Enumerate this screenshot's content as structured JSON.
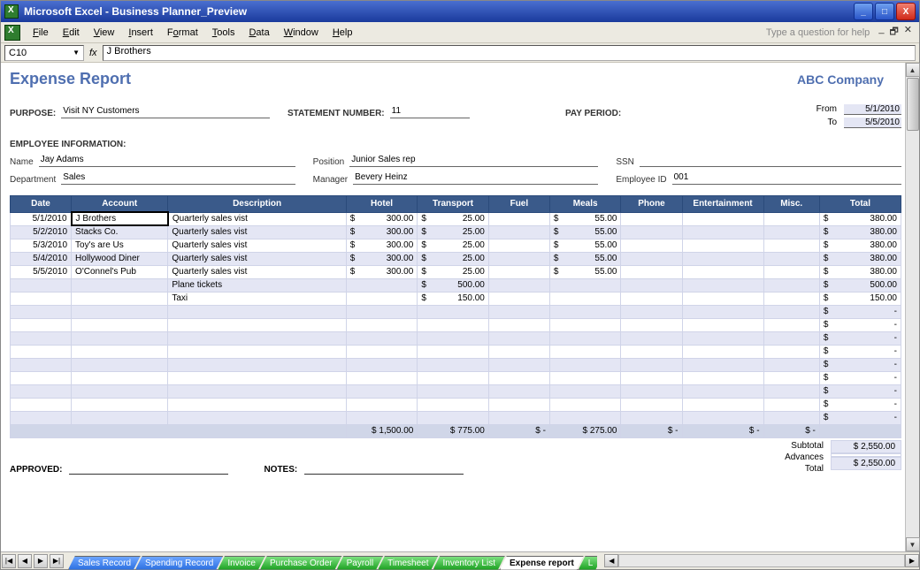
{
  "window": {
    "title": "Microsoft Excel - Business Planner_Preview"
  },
  "menu": {
    "file": "File",
    "edit": "Edit",
    "view": "View",
    "insert": "Insert",
    "format": "Format",
    "tools": "Tools",
    "data": "Data",
    "window": "Window",
    "help": "Help",
    "question_placeholder": "Type a question for help"
  },
  "formula_bar": {
    "cell_ref": "C10",
    "fx": "fx",
    "value": "J Brothers"
  },
  "report": {
    "title": "Expense Report",
    "company": "ABC Company",
    "purpose_label": "PURPOSE:",
    "purpose_value": "Visit NY Customers",
    "statement_label": "STATEMENT NUMBER:",
    "statement_value": "11",
    "payperiod_label": "PAY PERIOD:",
    "from_label": "From",
    "from_value": "5/1/2010",
    "to_label": "To",
    "to_value": "5/5/2010",
    "emp_section": "EMPLOYEE INFORMATION:",
    "name_label": "Name",
    "name_value": "Jay Adams",
    "dept_label": "Department",
    "dept_value": "Sales",
    "position_label": "Position",
    "position_value": "Junior Sales rep",
    "manager_label": "Manager",
    "manager_value": "Bevery Heinz",
    "ssn_label": "SSN",
    "ssn_value": "",
    "empid_label": "Employee ID",
    "empid_value": "001",
    "approved_label": "APPROVED:",
    "notes_label": "NOTES:"
  },
  "columns": {
    "date": "Date",
    "account": "Account",
    "description": "Description",
    "hotel": "Hotel",
    "transport": "Transport",
    "fuel": "Fuel",
    "meals": "Meals",
    "phone": "Phone",
    "entertainment": "Entertainment",
    "misc": "Misc.",
    "total": "Total"
  },
  "rows": [
    {
      "date": "5/1/2010",
      "account": "J Brothers",
      "desc": "Quarterly sales vist",
      "hotel": "300.00",
      "transport": "25.00",
      "fuel": "",
      "meals": "55.00",
      "phone": "",
      "ent": "",
      "misc": "",
      "total": "380.00",
      "selected": true
    },
    {
      "date": "5/2/2010",
      "account": "Stacks Co.",
      "desc": "Quarterly sales vist",
      "hotel": "300.00",
      "transport": "25.00",
      "fuel": "",
      "meals": "55.00",
      "phone": "",
      "ent": "",
      "misc": "",
      "total": "380.00"
    },
    {
      "date": "5/3/2010",
      "account": "Toy's are Us",
      "desc": "Quarterly sales vist",
      "hotel": "300.00",
      "transport": "25.00",
      "fuel": "",
      "meals": "55.00",
      "phone": "",
      "ent": "",
      "misc": "",
      "total": "380.00"
    },
    {
      "date": "5/4/2010",
      "account": "Hollywood Diner",
      "desc": "Quarterly sales vist",
      "hotel": "300.00",
      "transport": "25.00",
      "fuel": "",
      "meals": "55.00",
      "phone": "",
      "ent": "",
      "misc": "",
      "total": "380.00"
    },
    {
      "date": "5/5/2010",
      "account": "O'Connel's Pub",
      "desc": "Quarterly sales vist",
      "hotel": "300.00",
      "transport": "25.00",
      "fuel": "",
      "meals": "55.00",
      "phone": "",
      "ent": "",
      "misc": "",
      "total": "380.00"
    },
    {
      "date": "",
      "account": "",
      "desc": "Plane tickets",
      "hotel": "",
      "transport": "500.00",
      "fuel": "",
      "meals": "",
      "phone": "",
      "ent": "",
      "misc": "",
      "total": "500.00"
    },
    {
      "date": "",
      "account": "",
      "desc": "Taxi",
      "hotel": "",
      "transport": "150.00",
      "fuel": "",
      "meals": "",
      "phone": "",
      "ent": "",
      "misc": "",
      "total": "150.00"
    },
    {
      "date": "",
      "account": "",
      "desc": "",
      "hotel": "",
      "transport": "",
      "fuel": "",
      "meals": "",
      "phone": "",
      "ent": "",
      "misc": "",
      "total": "-"
    },
    {
      "date": "",
      "account": "",
      "desc": "",
      "hotel": "",
      "transport": "",
      "fuel": "",
      "meals": "",
      "phone": "",
      "ent": "",
      "misc": "",
      "total": "-"
    },
    {
      "date": "",
      "account": "",
      "desc": "",
      "hotel": "",
      "transport": "",
      "fuel": "",
      "meals": "",
      "phone": "",
      "ent": "",
      "misc": "",
      "total": "-"
    },
    {
      "date": "",
      "account": "",
      "desc": "",
      "hotel": "",
      "transport": "",
      "fuel": "",
      "meals": "",
      "phone": "",
      "ent": "",
      "misc": "",
      "total": "-"
    },
    {
      "date": "",
      "account": "",
      "desc": "",
      "hotel": "",
      "transport": "",
      "fuel": "",
      "meals": "",
      "phone": "",
      "ent": "",
      "misc": "",
      "total": "-"
    },
    {
      "date": "",
      "account": "",
      "desc": "",
      "hotel": "",
      "transport": "",
      "fuel": "",
      "meals": "",
      "phone": "",
      "ent": "",
      "misc": "",
      "total": "-"
    },
    {
      "date": "",
      "account": "",
      "desc": "",
      "hotel": "",
      "transport": "",
      "fuel": "",
      "meals": "",
      "phone": "",
      "ent": "",
      "misc": "",
      "total": "-"
    },
    {
      "date": "",
      "account": "",
      "desc": "",
      "hotel": "",
      "transport": "",
      "fuel": "",
      "meals": "",
      "phone": "",
      "ent": "",
      "misc": "",
      "total": "-"
    },
    {
      "date": "",
      "account": "",
      "desc": "",
      "hotel": "",
      "transport": "",
      "fuel": "",
      "meals": "",
      "phone": "",
      "ent": "",
      "misc": "",
      "total": "-"
    }
  ],
  "totals": {
    "hotel": "$ 1,500.00",
    "transport": "$    775.00",
    "fuel": "$        -",
    "meals": "$    275.00",
    "phone": "$        -",
    "ent": "$        -",
    "misc": "$        -",
    "total": ""
  },
  "summary": {
    "subtotal_label": "Subtotal",
    "subtotal_value": "$  2,550.00",
    "advances_label": "Advances",
    "advances_value": "",
    "total_label": "Total",
    "total_value": "$  2,550.00"
  },
  "tabs": [
    {
      "label": "Sales Record",
      "style": "blue"
    },
    {
      "label": "Spending Record",
      "style": "blue"
    },
    {
      "label": "Invoice",
      "style": "green"
    },
    {
      "label": "Purchase Order",
      "style": "green"
    },
    {
      "label": "Payroll",
      "style": "green"
    },
    {
      "label": "Timesheet",
      "style": "green"
    },
    {
      "label": "Inventory List",
      "style": "green"
    },
    {
      "label": "Expense report",
      "style": "active"
    },
    {
      "label": "L",
      "style": "green"
    }
  ]
}
